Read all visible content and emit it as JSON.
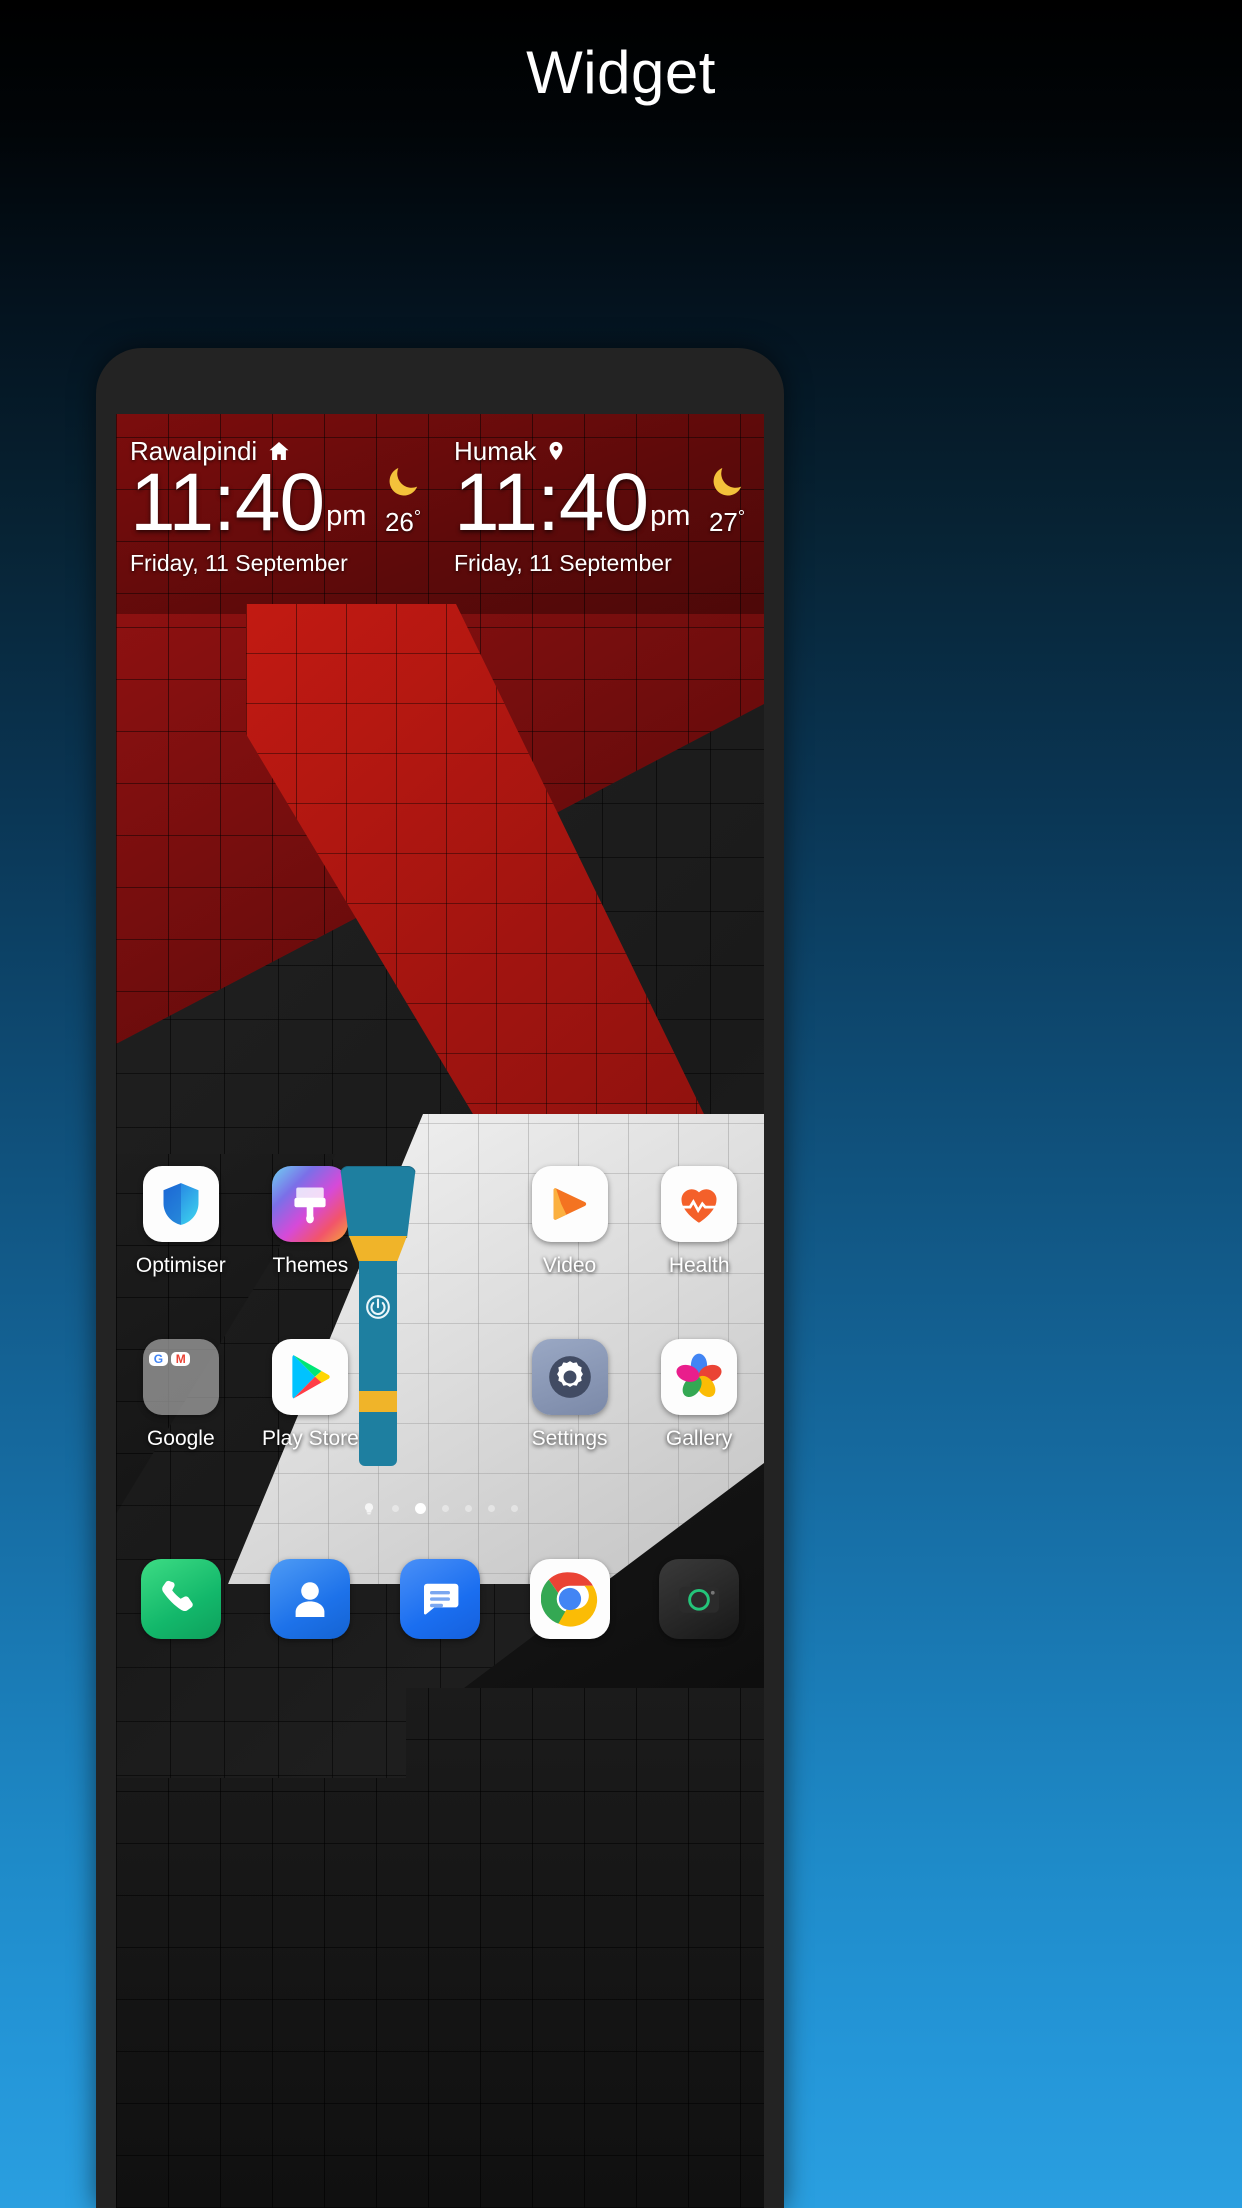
{
  "header": {
    "title": "Widget"
  },
  "clock_widget": {
    "left": {
      "city": "Rawalpindi",
      "city_icon": "home-icon",
      "time": "11:40",
      "ampm": "pm",
      "date": "Friday, 11 September",
      "weather_icon": "crescent-moon-icon",
      "temperature": "26",
      "degree": "°"
    },
    "right": {
      "city": "Humak",
      "city_icon": "location-pin-icon",
      "time": "11:40",
      "ampm": "pm",
      "date": "Friday, 11 September",
      "weather_icon": "crescent-moon-icon",
      "temperature": "27",
      "degree": "°"
    }
  },
  "flashlight_widget": {
    "name": "flashlight",
    "power_icon": "power-button-icon",
    "body_color": "#1e7fa0",
    "band_color": "#f0b429"
  },
  "home_screen": {
    "row1": [
      {
        "label": "Optimiser",
        "icon": "shield-icon"
      },
      {
        "label": "Themes",
        "icon": "paint-brush-icon"
      },
      {
        "label": "",
        "icon": "flashlight-widget-slot"
      },
      {
        "label": "Video",
        "icon": "video-play-icon"
      },
      {
        "label": "Health",
        "icon": "heart-icon"
      }
    ],
    "row2": [
      {
        "label": "Google",
        "icon": "google-folder-icon"
      },
      {
        "label": "Play Store",
        "icon": "play-store-icon"
      },
      {
        "label": "",
        "icon": "flashlight-widget-slot"
      },
      {
        "label": "Settings",
        "icon": "gear-icon"
      },
      {
        "label": "Gallery",
        "icon": "gallery-pinwheel-icon"
      }
    ],
    "google_folder_apps": [
      "google-search-icon",
      "gmail-icon",
      "maps-icon",
      "youtube-icon",
      "drive-icon",
      "podcasts-icon",
      "meet-icon",
      "photos-icon",
      "docs-icon"
    ],
    "page_dots": {
      "count": 7,
      "active_index": 2,
      "bulb_index": 0
    },
    "dock": [
      {
        "label": "Phone",
        "icon": "phone-handset-icon"
      },
      {
        "label": "Contacts",
        "icon": "person-icon"
      },
      {
        "label": "Messages",
        "icon": "chat-bubble-icon"
      },
      {
        "label": "Chrome",
        "icon": "chrome-icon"
      },
      {
        "label": "Camera",
        "icon": "camera-icon"
      }
    ]
  },
  "colors": {
    "background_top": "#000000",
    "background_bottom": "#2a9fe0",
    "wallpaper_red": "#c21a12",
    "wallpaper_black": "#1a1a1a",
    "wallpaper_white": "#e8e8e8"
  }
}
